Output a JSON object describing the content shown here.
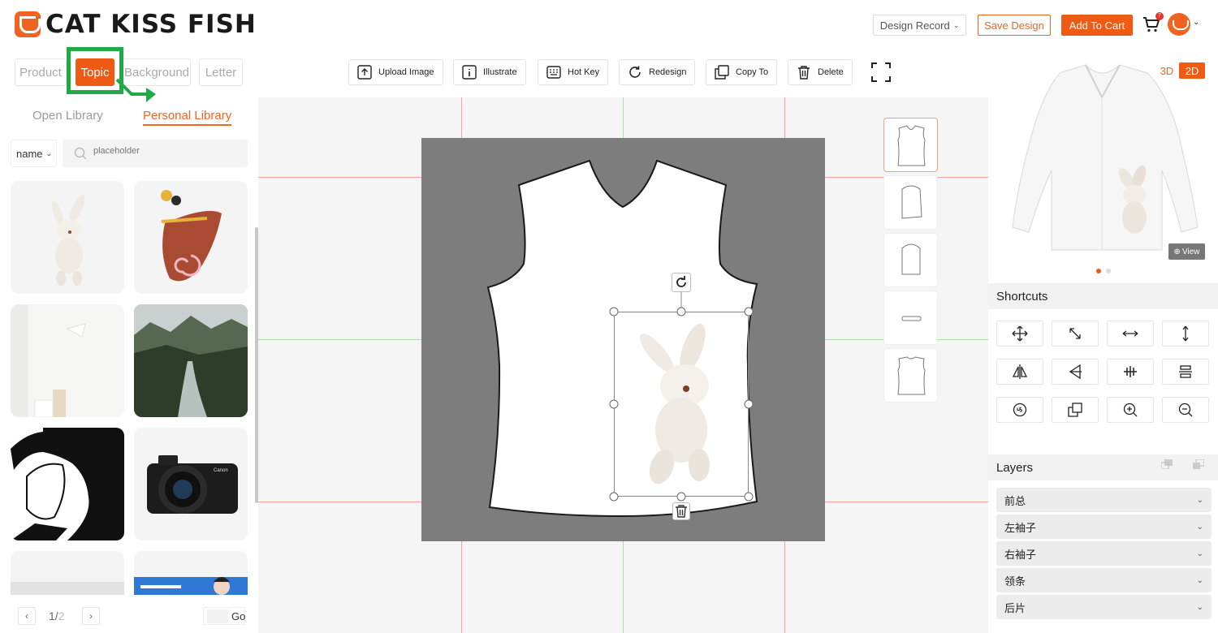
{
  "brand": {
    "name": "CAT KISS FISH",
    "accent": "#ef5a14",
    "highlight": "#21a847"
  },
  "header": {
    "design_record": "Design Record",
    "save_design": "Save Design",
    "add_to_cart": "Add To Cart",
    "cart_count": "7"
  },
  "left": {
    "category_tabs": [
      "Product",
      "Topic",
      "Background",
      "Letter"
    ],
    "active_category": "Topic",
    "library_tabs": [
      "Open Library",
      "Personal Library"
    ],
    "active_library": "Personal Library",
    "sort_value": "name",
    "search_placeholder": "placeholder",
    "assets": [
      "bunny-plush",
      "abstract-shapes",
      "white-lamp-room",
      "mountain-river",
      "anime-portrait",
      "canon-camera",
      "white-photo",
      "blue-banner"
    ],
    "pager": {
      "current": "1",
      "separator": "/",
      "total": "2",
      "go_label": "Go"
    }
  },
  "toolbar": {
    "upload": "Upload Image",
    "illustrate": "Illustrate",
    "hotkey": "Hot Key",
    "redesign": "Redesign",
    "copy_to": "Copy To",
    "delete": "Delete"
  },
  "right": {
    "mode_3d": "3D",
    "mode_2d": "2D",
    "active_mode": "2D",
    "view_label": "View",
    "shortcuts_title": "Shortcuts",
    "shortcut_icons": [
      "move-icon",
      "shrink-diagonal-icon",
      "stretch-horizontal-icon",
      "stretch-vertical-icon",
      "flip-horizontal-icon",
      "flip-vertical-icon",
      "align-center-vertical-icon",
      "align-center-horizontal-icon",
      "rotate-45-icon",
      "duplicate-icon",
      "zoom-in-icon",
      "zoom-out-icon"
    ],
    "layers_title": "Layers",
    "layers": [
      "前总",
      "左袖子",
      "右袖子",
      "领条",
      "后片"
    ]
  }
}
